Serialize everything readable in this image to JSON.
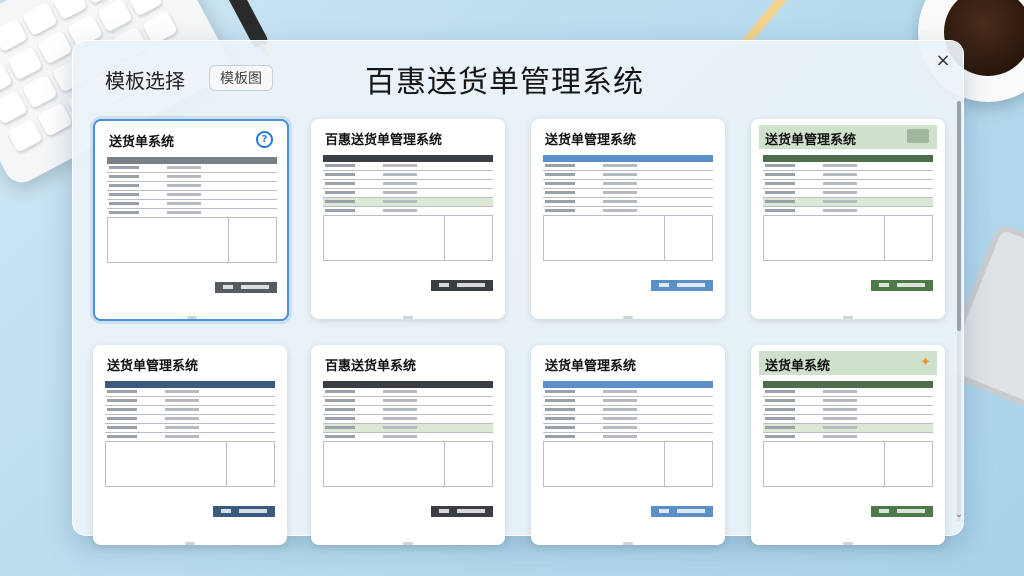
{
  "window": {
    "tab_label": "模板选择",
    "tab_badge": "模板图",
    "title": "百惠送货单管理系统",
    "close_glyph": "×",
    "scroll_down_glyph": "⌄"
  },
  "templates": [
    {
      "title": "送货单系统",
      "theme": "gray",
      "selected": true,
      "icon": "info-icon"
    },
    {
      "title": "百惠送货单管理系统",
      "theme": "dark",
      "selected": false,
      "icon": ""
    },
    {
      "title": "送货单管理系统",
      "theme": "blue",
      "selected": false,
      "icon": ""
    },
    {
      "title": "送货单管理系统",
      "theme": "green",
      "selected": false,
      "icon": "stamp-icon"
    },
    {
      "title": "送货单管理系统",
      "theme": "navy",
      "selected": false,
      "icon": ""
    },
    {
      "title": "百惠送货单系统",
      "theme": "dark",
      "selected": false,
      "icon": ""
    },
    {
      "title": "送货单管理系统",
      "theme": "blue",
      "selected": false,
      "icon": ""
    },
    {
      "title": "送货单系统",
      "theme": "green",
      "selected": false,
      "icon": "orange-icon"
    }
  ],
  "colors": {
    "accent": "#4a90d9",
    "gray": "#565c62",
    "blue": "#5b8fc8",
    "dark": "#3a3d42",
    "green": "#4e7a4a",
    "navy": "#3c5a80"
  }
}
